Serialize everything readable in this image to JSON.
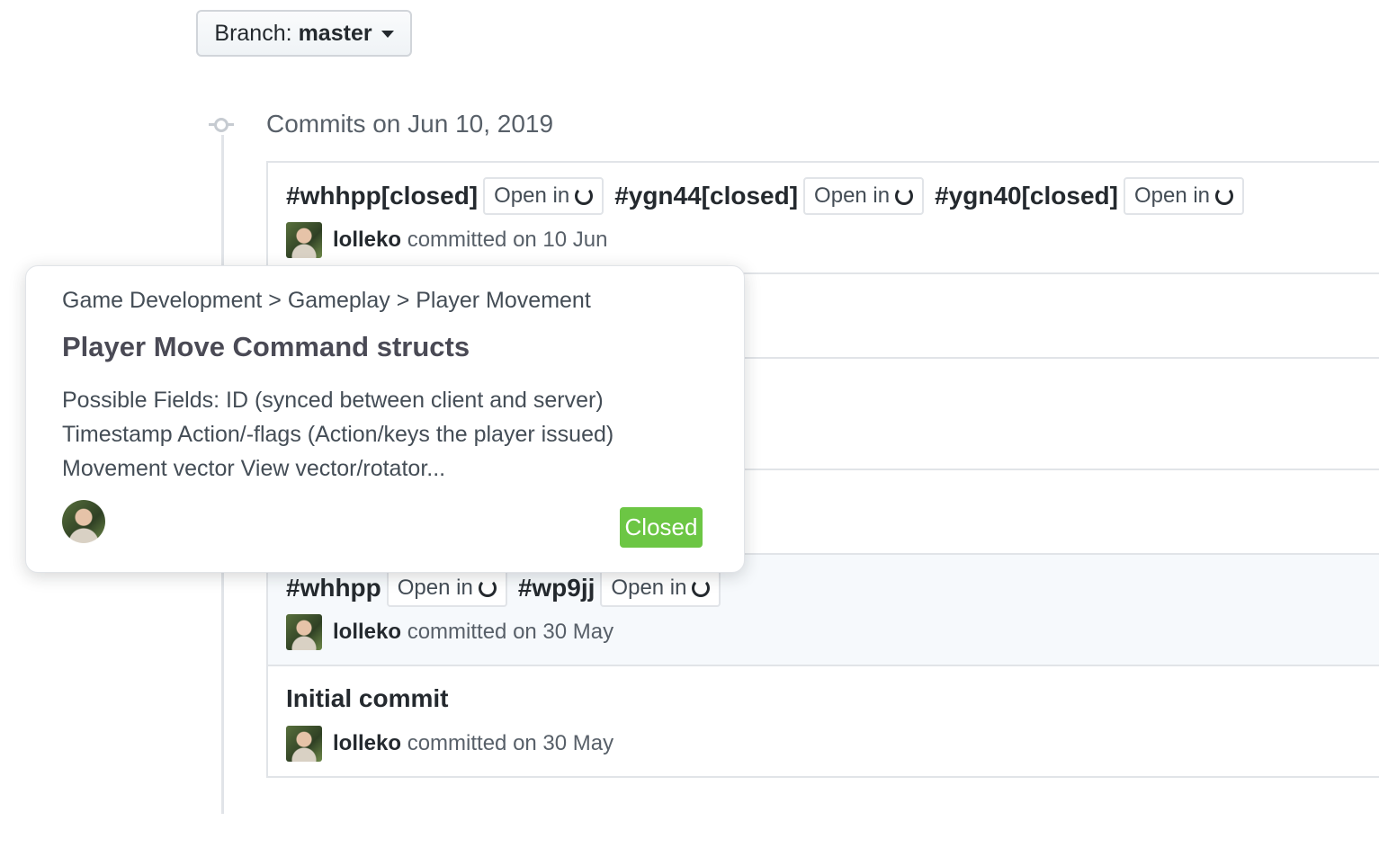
{
  "branch": {
    "label": "Branch:",
    "value": "master"
  },
  "group": {
    "title": "Commits on Jun 10, 2019"
  },
  "commits": [
    {
      "items": [
        {
          "ref": "#whhpp[closed]",
          "open_label": "Open in"
        },
        {
          "ref": "#ygn44[closed]",
          "open_label": "Open in"
        },
        {
          "ref": "#ygn40[closed]",
          "open_label": "Open in"
        }
      ],
      "author": "lolleko",
      "action": "committed on 10 Jun"
    },
    {
      "items": [
        {
          "ref": "#whhpp",
          "open_label": "Open in"
        },
        {
          "ref": "#wp9jj",
          "open_label": "Open in"
        }
      ],
      "author": "lolleko",
      "action": "committed on 30 May"
    },
    {
      "title": "Initial commit",
      "author": "lolleko",
      "action": "committed on 30 May"
    }
  ],
  "hovercard": {
    "breadcrumb": "Game Development > Gameplay > Player Movement",
    "title": "Player Move Command structs",
    "body": [
      "Possible Fields: ID (synced between client and server)",
      "Timestamp Action/-flags (Action/keys the player issued)",
      "Movement vector View vector/rotator..."
    ],
    "status": "Closed",
    "status_color": "#6cc644"
  }
}
